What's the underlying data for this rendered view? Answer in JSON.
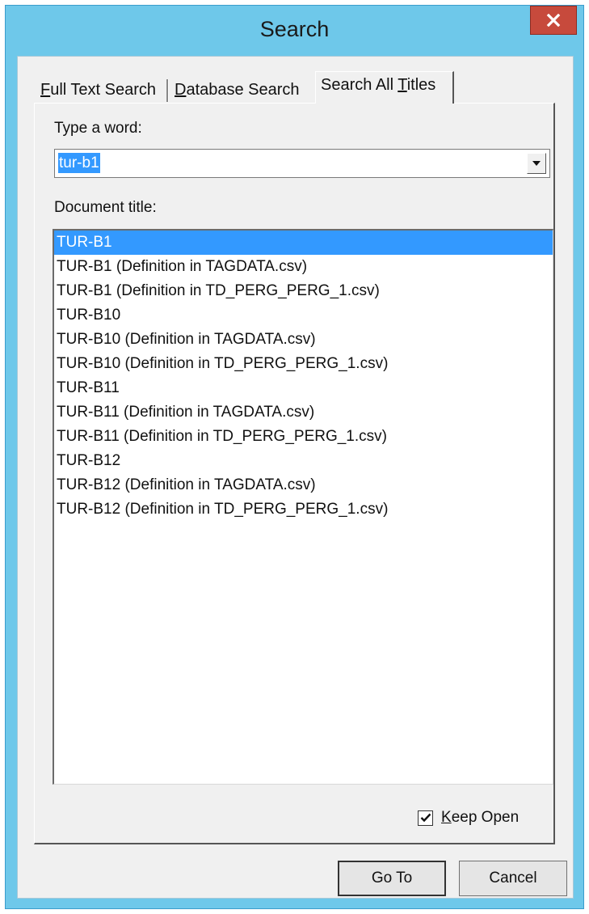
{
  "window": {
    "title": "Search",
    "close_glyph": "x"
  },
  "tabs": {
    "full_text_search": {
      "pre": "",
      "key": "F",
      "post": "ull Text Search"
    },
    "database_search": {
      "pre": "",
      "key": "D",
      "post": "atabase Search"
    },
    "search_all_titles": {
      "pre": "Search All ",
      "key": "T",
      "post": "itles"
    }
  },
  "search": {
    "word_label": "Type a word:",
    "word_value": "tur-b1",
    "title_label": "Document title:"
  },
  "results": [
    "TUR-B1",
    "TUR-B1 (Definition in TAGDATA.csv)",
    "TUR-B1 (Definition in TD_PERG_PERG_1.csv)",
    "TUR-B10",
    "TUR-B10 (Definition in TAGDATA.csv)",
    "TUR-B10 (Definition in TD_PERG_PERG_1.csv)",
    "TUR-B11",
    "TUR-B11 (Definition in TAGDATA.csv)",
    "TUR-B11 (Definition in TD_PERG_PERG_1.csv)",
    "TUR-B12",
    "TUR-B12 (Definition in TAGDATA.csv)",
    "TUR-B12 (Definition in TD_PERG_PERG_1.csv)"
  ],
  "selected_result": "TUR-B1",
  "keep_open": {
    "checked": true,
    "key": "K",
    "post": "eep Open"
  },
  "buttons": {
    "goto": "Go To",
    "cancel": "Cancel"
  },
  "icons": {
    "close": "close-icon",
    "dropdown": "chevron-down-icon",
    "check": "check-icon"
  }
}
